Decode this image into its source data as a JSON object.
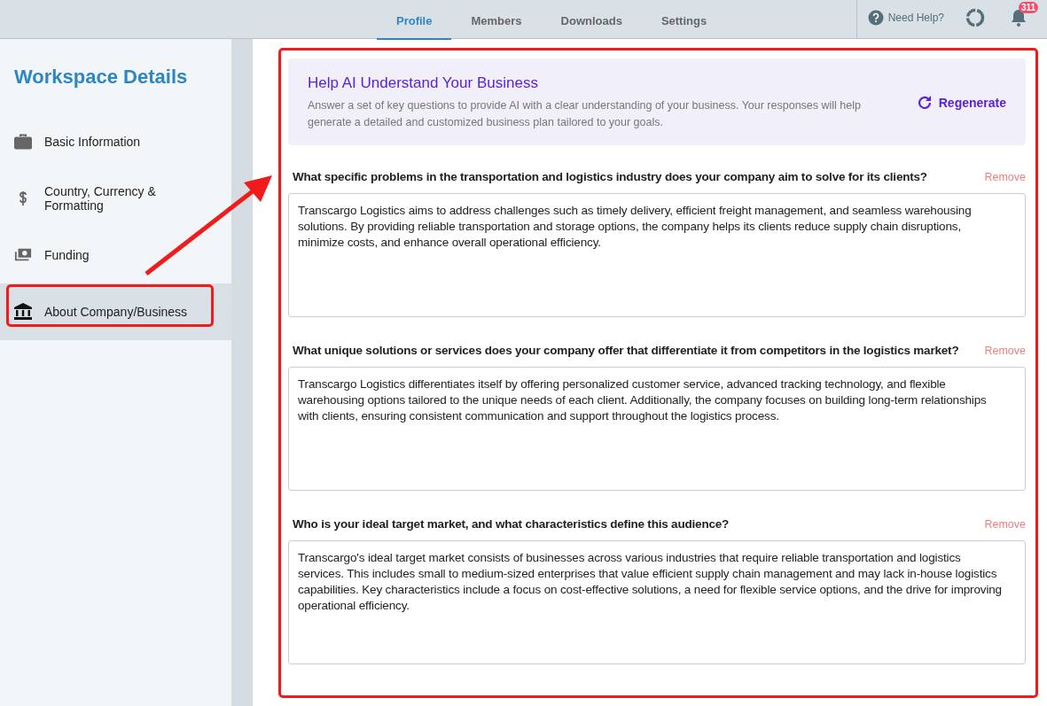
{
  "top_tabs": [
    {
      "label": "Profile",
      "selected": true
    },
    {
      "label": "Members",
      "selected": false
    },
    {
      "label": "Downloads",
      "selected": false
    },
    {
      "label": "Settings",
      "selected": false
    }
  ],
  "help": {
    "label": "Need Help?"
  },
  "notifications": {
    "count": "311"
  },
  "sidebar": {
    "title": "Workspace Details",
    "items": [
      {
        "label": "Basic Information",
        "selected": false
      },
      {
        "label": "Country, Currency & Formatting",
        "selected": false
      },
      {
        "label": "Funding",
        "selected": false
      },
      {
        "label": "About Company/Business",
        "selected": true
      }
    ]
  },
  "banner": {
    "title": "Help AI Understand Your Business",
    "text": "Answer a set of key questions to provide AI with a clear understanding of your business. Your responses will help generate a detailed and customized business plan tailored to your goals.",
    "button": "Regenerate"
  },
  "questions": [
    {
      "question": "What specific problems in the transportation and logistics industry does your company aim to solve for its clients?",
      "remove": "Remove",
      "answer": "Transcargo Logistics aims to address challenges such as timely delivery, efficient freight management, and seamless warehousing solutions. By providing reliable transportation and storage options, the company helps its clients reduce supply chain disruptions, minimize costs, and enhance overall operational efficiency."
    },
    {
      "question": "What unique solutions or services does your company offer that differentiate it from competitors in the logistics market?",
      "remove": "Remove",
      "answer": "Transcargo Logistics differentiates itself by offering personalized customer service, advanced tracking technology, and flexible warehousing options tailored to the unique needs of each client. Additionally, the company focuses on building long-term relationships with clients, ensuring consistent communication and support throughout the logistics process."
    },
    {
      "question": "Who is your ideal target market, and what characteristics define this audience?",
      "remove": "Remove",
      "answer": "Transcargo's ideal target market consists of businesses across various industries that require reliable transportation and logistics services. This includes small to medium-sized enterprises that value efficient supply chain management and may lack in-house logistics capabilities. Key characteristics include a focus on cost-effective solutions, a need for flexible service options, and the drive for improving operational efficiency."
    }
  ]
}
